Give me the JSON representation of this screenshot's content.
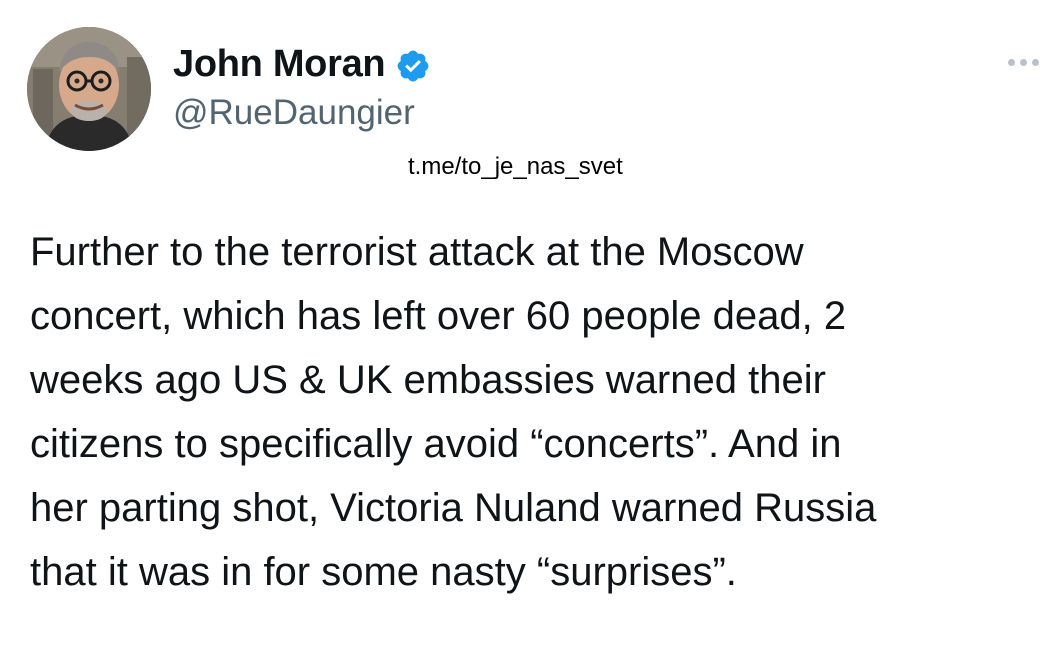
{
  "author": {
    "display_name": "John Moran",
    "handle": "@RueDaungier",
    "verified": true,
    "avatar_icon": "profile-photo",
    "verified_icon": "verified-badge-icon",
    "verified_color": "#1d9bf0"
  },
  "actions": {
    "more_icon": "more-options-icon"
  },
  "watermark": "t.me/to_je_nas_svet",
  "tweet": {
    "lines": [
      "Further to the terrorist attack at the Moscow",
      "concert, which has left over 60 people dead, 2",
      "weeks ago US & UK embassies warned their",
      "citizens to specifically avoid “concerts”. And in",
      "her parting shot, Victoria Nuland warned Russia",
      "that it was in for some nasty “surprises”."
    ]
  },
  "colors": {
    "text": "#0f1419",
    "secondary_text": "#536471",
    "background": "#ffffff"
  }
}
